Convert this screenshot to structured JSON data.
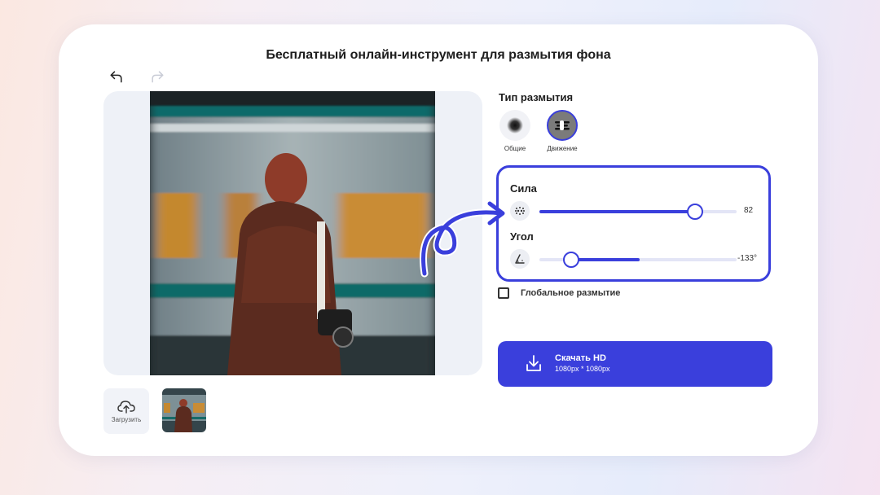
{
  "page": {
    "title": "Бесплатный онлайн-инструмент для размытия фона"
  },
  "history": {
    "undo_icon": "undo-arrow-icon",
    "redo_icon": "redo-arrow-icon"
  },
  "upload": {
    "label": "Загрузить",
    "icon": "cloud-upload-icon"
  },
  "blur_type": {
    "heading": "Тип размытия",
    "options": [
      {
        "label": "Общие",
        "icon": "blur-dot-icon",
        "selected": false
      },
      {
        "label": "Движение",
        "icon": "motion-lines-icon",
        "selected": true
      }
    ]
  },
  "controls": {
    "strength": {
      "label": "Сила",
      "value": 82,
      "display": "82",
      "fraction": 0.79
    },
    "angle": {
      "label": "Угол",
      "value": -133,
      "display": "-133°",
      "fraction": 0.16
    }
  },
  "global_blur": {
    "label": "Глобальное размытие",
    "checked": false
  },
  "download": {
    "title": "Скачать HD",
    "subtitle": "1080px * 1080px",
    "icon": "download-icon"
  },
  "colors": {
    "accent": "#3a3fdc",
    "card": "#ffffff",
    "panel": "#eef1f7"
  }
}
